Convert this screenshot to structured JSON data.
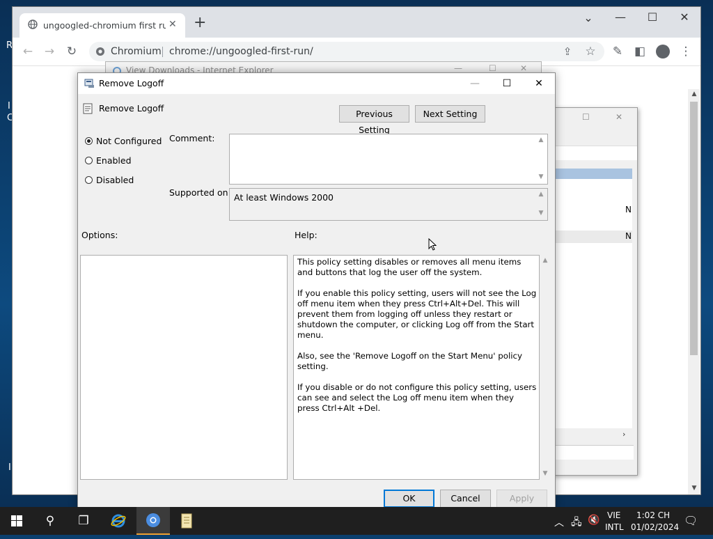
{
  "desktop": {
    "edge_letters": [
      "R",
      "I",
      "C",
      "I"
    ]
  },
  "browser": {
    "tab_title": "ungoogled-chromium first run p",
    "new_tab_glyph": "+",
    "site_label": "Chromium",
    "url": "chrome://ungoogled-first-run/"
  },
  "background_windows": {
    "ie_title": "View Downloads - Internet Explorer",
    "list_marks": [
      "N",
      "N"
    ]
  },
  "dialog": {
    "title": "Remove Logoff",
    "policy_name": "Remove Logoff",
    "prev_button": "Previous Setting",
    "next_button": "Next Setting",
    "radios": [
      {
        "label": "Not Configured",
        "checked": true
      },
      {
        "label": "Enabled",
        "checked": false
      },
      {
        "label": "Disabled",
        "checked": false
      }
    ],
    "comment_label": "Comment:",
    "comment_value": "",
    "supported_label": "Supported on:",
    "supported_value": "At least Windows 2000",
    "options_label": "Options:",
    "help_label": "Help:",
    "help_text": "This policy setting disables or removes all menu items and buttons that log the user off the system.\n\nIf you enable this policy setting, users will not see the Log off menu item when they press Ctrl+Alt+Del. This will prevent them from logging off unless they restart or shutdown the computer, or clicking Log off from the Start menu.\n\nAlso, see the 'Remove Logoff on the Start Menu' policy setting.\n\nIf you disable or do not configure this policy setting, users can see and select the Log off menu item when they press Ctrl+Alt +Del.",
    "ok_button": "OK",
    "cancel_button": "Cancel",
    "apply_button": "Apply"
  },
  "taskbar": {
    "lang_top": "VIE",
    "lang_bottom": "INTL",
    "time": "1:02 CH",
    "date": "01/02/2024"
  },
  "colors": {
    "accent": "#0078d7",
    "taskbar": "#1f1f1f",
    "chrome_tab_active": "#f0a030"
  }
}
